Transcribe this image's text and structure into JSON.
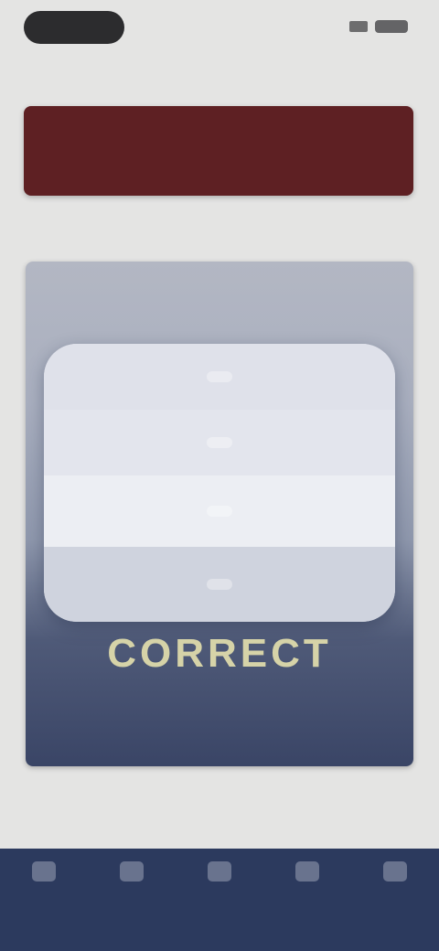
{
  "header": {
    "title": "",
    "back_label": ""
  },
  "banner": {
    "color": "#5e2023"
  },
  "sections": {
    "label_1": "",
    "label_2": ""
  },
  "dialog": {
    "options": [
      {
        "label": ""
      },
      {
        "label": ""
      },
      {
        "label": ""
      },
      {
        "label": ""
      }
    ],
    "big_text": "CORRECT"
  },
  "tabs": [
    {
      "label": "",
      "icon": "home-icon"
    },
    {
      "label": "",
      "icon": "book-icon"
    },
    {
      "label": "",
      "icon": "chart-icon"
    },
    {
      "label": "",
      "icon": "settings-icon"
    },
    {
      "label": "",
      "icon": "profile-icon"
    }
  ],
  "colors": {
    "tab_bar": "#2c3a5e",
    "background": "#e4e4e3"
  }
}
